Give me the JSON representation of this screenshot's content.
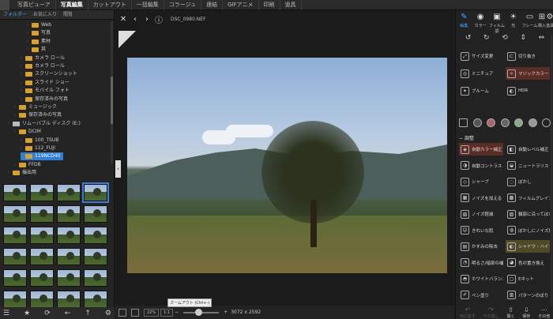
{
  "menu": [
    "写真ビューア",
    "写真編集",
    "カットアウト",
    "一括編集",
    "コラージュ",
    "連結",
    "GIFアニメ",
    "印刷",
    "道具"
  ],
  "menu_active": 1,
  "left_tabs": [
    "フォルダー",
    "お気に入り",
    "閲覧"
  ],
  "tree": [
    {
      "label": "Web",
      "level": 3,
      "type": "folder"
    },
    {
      "label": "写真",
      "level": 3,
      "type": "folder"
    },
    {
      "label": "素材",
      "level": 3,
      "type": "folder"
    },
    {
      "label": "其",
      "level": 3,
      "type": "folder"
    },
    {
      "label": "カメラ ロール",
      "level": 2,
      "type": "folder"
    },
    {
      "label": "カメラ ロール",
      "level": 2,
      "type": "folder"
    },
    {
      "label": "スクリーンショット",
      "level": 2,
      "type": "folder"
    },
    {
      "label": "スライド ショー",
      "level": 2,
      "type": "folder"
    },
    {
      "label": "モバイル フォト",
      "level": 2,
      "type": "folder"
    },
    {
      "label": "保存済みの写真",
      "level": 2,
      "type": "folder"
    },
    {
      "label": "ミュージック",
      "level": 1,
      "type": "folder"
    },
    {
      "label": "保存済みの写真",
      "level": 1,
      "type": "folder"
    },
    {
      "label": "リムーバブル ディスク (E:)",
      "level": 0,
      "type": "drive"
    },
    {
      "label": "DCIM",
      "level": 1,
      "type": "folder"
    },
    {
      "label": "100_TSUB",
      "level": 2,
      "type": "folder"
    },
    {
      "label": "112_FUJI",
      "level": 2,
      "type": "folder"
    },
    {
      "label": "119NCD40",
      "level": 2,
      "type": "folder",
      "selected": true
    },
    {
      "label": "FFDB",
      "level": 1,
      "type": "folder"
    },
    {
      "label": "撮出用",
      "level": 0,
      "type": "folder"
    }
  ],
  "thumbnail_count": 24,
  "thumbnail_selected": 3,
  "filename": "DSC_0980.NEF",
  "zoom": "22%",
  "zoom_fit": "1:1",
  "dimensions": "3072 x 2592",
  "tooltip": "ズームアウト (Ctrl+-)",
  "right_tools": [
    {
      "label": "編集",
      "icon": "✎",
      "active": true
    },
    {
      "label": "カラー",
      "icon": "◉"
    },
    {
      "label": "フィルム調",
      "icon": "▣"
    },
    {
      "label": "光",
      "icon": "☀"
    },
    {
      "label": "フレーム",
      "icon": "▭"
    },
    {
      "label": "挿入",
      "icon": "⊞"
    },
    {
      "label": "道具",
      "icon": "⚙"
    }
  ],
  "features": [
    {
      "label": "サイズ変更",
      "icon": "⤢"
    },
    {
      "label": "切り抜き",
      "icon": "⊏"
    },
    {
      "label": "ミニチュア",
      "icon": "◎"
    },
    {
      "label": "マジックカラー",
      "icon": "✧",
      "highlight": "red"
    },
    {
      "label": "ブルーム",
      "icon": "✦"
    },
    {
      "label": "HDR",
      "icon": "◐"
    }
  ],
  "section_title": "調整",
  "adjustments": [
    {
      "label": "自動カラー補正",
      "icon": "◈",
      "highlight": "red"
    },
    {
      "label": "自動レベル補正",
      "icon": "◧"
    },
    {
      "label": "自動コントラスト",
      "icon": "◑"
    },
    {
      "label": "ニュートラリス",
      "icon": "◒"
    },
    {
      "label": "シャープ",
      "icon": "◇"
    },
    {
      "label": "ぼかし",
      "icon": "◌"
    },
    {
      "label": "ノイズを加える",
      "icon": "▦"
    },
    {
      "label": "フィルムグレイン",
      "icon": "▩"
    },
    {
      "label": "ノイズ軽減",
      "icon": "▧"
    },
    {
      "label": "輪郭に沿ってぼかし",
      "icon": "▨"
    },
    {
      "label": "きれいな肌",
      "icon": "☺"
    },
    {
      "label": "ぼかしにノイズ抑",
      "icon": "◍"
    },
    {
      "label": "かすみの除去",
      "icon": "▤"
    },
    {
      "label": "シャドウ・ハイラ",
      "icon": "◐",
      "highlight": "yellow"
    },
    {
      "label": "明るさ/暗部の補正",
      "icon": "◔"
    },
    {
      "label": "色の置き換え",
      "icon": "◕"
    },
    {
      "label": "ホワイトバランス",
      "icon": "◓"
    },
    {
      "label": "Eネット",
      "icon": "▢"
    },
    {
      "label": "ペン塗り",
      "icon": "✐"
    },
    {
      "label": "パターンのぼり",
      "icon": "▥"
    }
  ],
  "bottom_actions": [
    {
      "label": "元に戻す",
      "icon": "↶",
      "dim": true
    },
    {
      "label": "やり直し",
      "icon": "↷",
      "dim": true
    },
    {
      "label": "開く",
      "icon": "⇧"
    },
    {
      "label": "保存",
      "icon": "⇩"
    },
    {
      "label": "その他",
      "icon": "⋯"
    }
  ]
}
